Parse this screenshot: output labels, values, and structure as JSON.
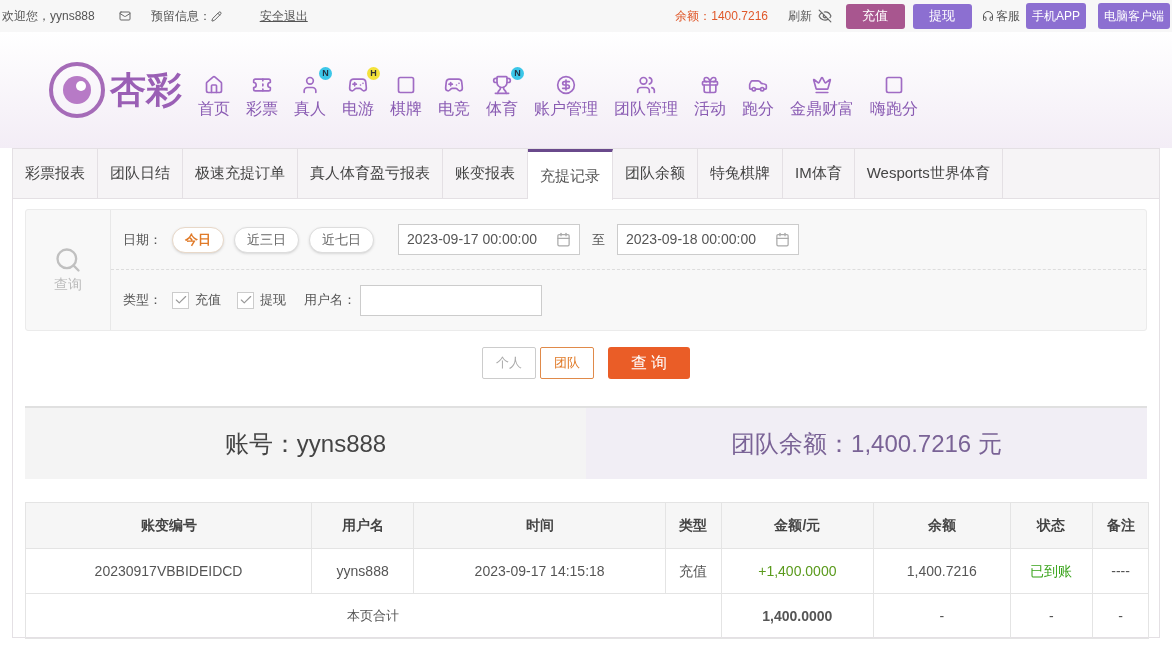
{
  "top_bar": {
    "welcome": "欢迎您，yyns888",
    "reserved_info_label": "预留信息：",
    "logout": "安全退出",
    "balance": "余额：1400.7216",
    "refresh": "刷新",
    "buttons": [
      {
        "label": "充值",
        "kind": "deposit"
      },
      {
        "label": "提现",
        "kind": "withdraw"
      }
    ],
    "service": "客服",
    "app_buttons": [
      "手机APP",
      "电脑客户端"
    ]
  },
  "nav": {
    "logo": "杏彩",
    "items": [
      {
        "label": "首页"
      },
      {
        "label": "彩票"
      },
      {
        "label": "真人",
        "badge": "N"
      },
      {
        "label": "电游",
        "badge": "H"
      },
      {
        "label": "棋牌"
      },
      {
        "label": "电竞"
      },
      {
        "label": "体育",
        "badge": "N"
      },
      {
        "label": "账户管理"
      },
      {
        "label": "团队管理"
      },
      {
        "label": "活动"
      },
      {
        "label": "跑分"
      },
      {
        "label": "金鼎财富"
      },
      {
        "label": "嗨跑分"
      }
    ]
  },
  "tabs": [
    {
      "label": "彩票报表",
      "selected": false
    },
    {
      "label": "团队日结",
      "selected": false
    },
    {
      "label": "极速充提订单",
      "selected": false
    },
    {
      "label": "真人体育盈亏报表",
      "selected": false
    },
    {
      "label": "账变报表",
      "selected": false
    },
    {
      "label": "充提记录",
      "selected": true
    },
    {
      "label": "团队余额",
      "selected": false
    },
    {
      "label": "特兔棋牌",
      "selected": false
    },
    {
      "label": "IM体育",
      "selected": false
    },
    {
      "label": "Wesports世界体育",
      "selected": false
    }
  ],
  "filter": {
    "search_label": "查询",
    "date_label": "日期：",
    "date_presets": [
      {
        "label": "今日",
        "selected": true
      },
      {
        "label": "近三日",
        "selected": false
      },
      {
        "label": "近七日",
        "selected": false
      }
    ],
    "date_from": "2023-09-17 00:00:00",
    "date_to_label": "至",
    "date_to": "2023-09-18 00:00:00",
    "type_label": "类型：",
    "types": [
      {
        "label": "充值",
        "checked": true
      },
      {
        "label": "提现",
        "checked": true
      }
    ],
    "username_label": "用户名："
  },
  "scope_buttons": [
    {
      "label": "个人",
      "selected": false
    },
    {
      "label": "团队",
      "selected": true
    }
  ],
  "query_button": "查 询",
  "summary": {
    "account": "账号：yyns888",
    "team_balance": "团队余额：1,400.7216 元"
  },
  "table": {
    "columns": [
      "账变编号",
      "用户名",
      "时间",
      "类型",
      "金额/元",
      "余额",
      "状态",
      "备注"
    ],
    "rows": [
      [
        "20230917VBBIDEIDCD",
        "yyns888",
        "2023-09-17 14:15:18",
        "充值",
        "+1,400.0000",
        "1,400.7216",
        "已到账",
        "----"
      ]
    ],
    "total": {
      "label": "本页合计",
      "amount": "1,400.0000",
      "balance": "-",
      "status": "-",
      "note": "-"
    }
  }
}
